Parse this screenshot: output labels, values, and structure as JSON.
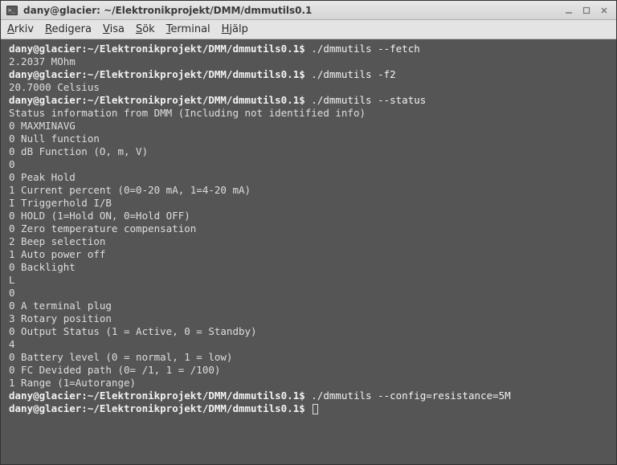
{
  "titlebar": {
    "title": "dany@glacier: ~/Elektronikprojekt/DMM/dmmutils0.1"
  },
  "menubar": {
    "items": [
      {
        "pre": "",
        "ul": "A",
        "post": "rkiv"
      },
      {
        "pre": "",
        "ul": "R",
        "post": "edigera"
      },
      {
        "pre": "",
        "ul": "V",
        "post": "isa"
      },
      {
        "pre": "",
        "ul": "S",
        "post": "ök"
      },
      {
        "pre": "",
        "ul": "T",
        "post": "erminal"
      },
      {
        "pre": "",
        "ul": "H",
        "post": "jälp"
      }
    ]
  },
  "terminal": {
    "prompt": "dany@glacier:~/Elektronikprojekt/DMM/dmmutils0.1$",
    "commands": {
      "c1": "./dmmutils --fetch",
      "c2": "./dmmutils -f2",
      "c3": "./dmmutils --status",
      "c4": "./dmmutils --config=resistance=5M"
    },
    "output": {
      "o1": "2.2037 MOhm",
      "o2": "20.7000 Celsius",
      "o3_header": "Status information from DMM (Including not identified info)",
      "o3_lines": [
        "",
        "0 MAXMINAVG",
        "0 Null function",
        "0 dB Function (O, m, V)",
        "0",
        "0 Peak Hold",
        "1 Current percent (0=0-20 mA, 1=4-20 mA)",
        "I Triggerhold I/B",
        "0 HOLD (1=Hold ON, 0=Hold OFF)",
        "0 Zero temperature compensation",
        "2 Beep selection",
        "1 Auto power off",
        "0 Backlight",
        "L",
        "0",
        "0 A terminal plug",
        "3 Rotary position",
        "0 Output Status (1 = Active, 0 = Standby)",
        "4",
        "0 Battery level (0 = normal, 1 = low)",
        "0 FC Devided path (0= /1, 1 = /100)",
        "1 Range (1=Autorange)"
      ]
    }
  }
}
